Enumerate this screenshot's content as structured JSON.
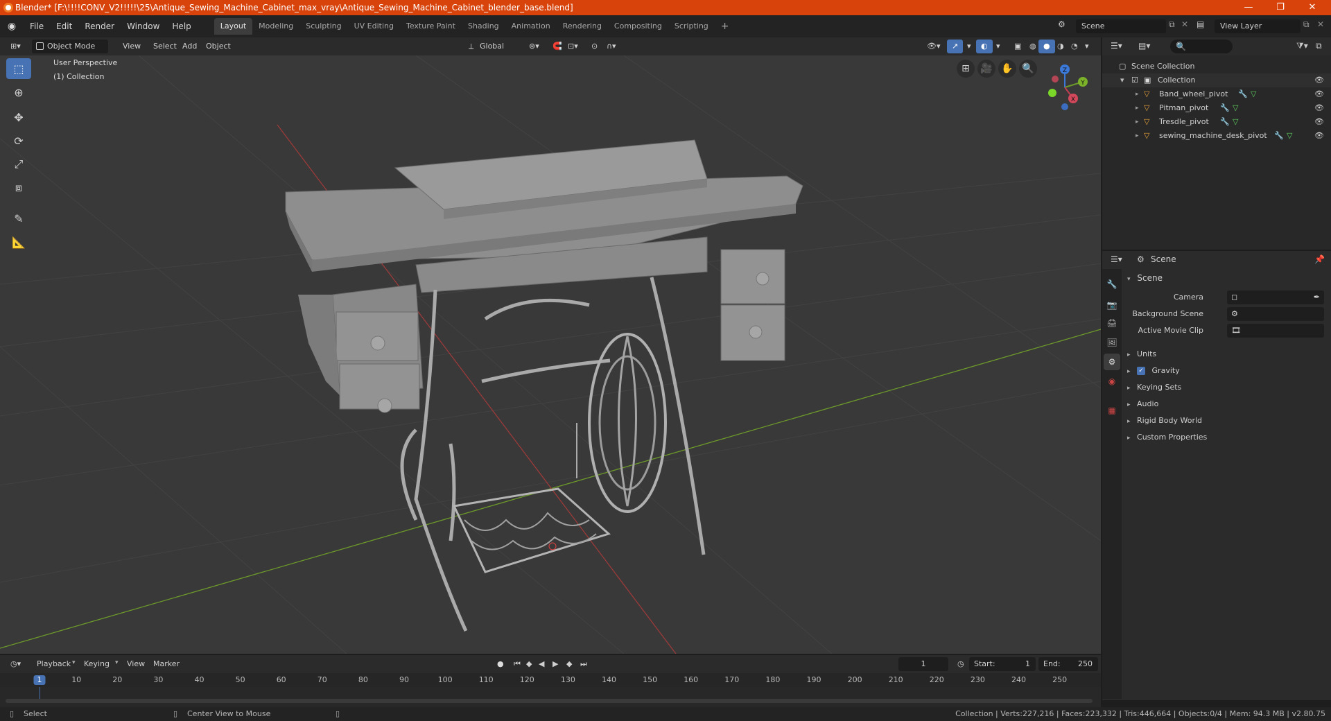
{
  "titlebar": {
    "title": "Blender* [F:\\!!!!CONV_V2!!!!!\\25\\Antique_Sewing_Machine_Cabinet_max_vray\\Antique_Sewing_Machine_Cabinet_blender_base.blend]",
    "minimize": "—",
    "restore": "❐",
    "close": "✕"
  },
  "menu": {
    "items": [
      "File",
      "Edit",
      "Render",
      "Window",
      "Help"
    ],
    "workspaces": [
      "Layout",
      "Modeling",
      "Sculpting",
      "UV Editing",
      "Texture Paint",
      "Shading",
      "Animation",
      "Rendering",
      "Compositing",
      "Scripting"
    ],
    "add_workspace": "+",
    "scene_label": "Scene",
    "view_layer_label": "View Layer"
  },
  "viewport_header": {
    "mode": "Object Mode",
    "menus": [
      "View",
      "Select",
      "Add",
      "Object"
    ],
    "orientation": "Global"
  },
  "viewport": {
    "perspective": "User Perspective",
    "collection": "(1) Collection",
    "axis_x": "X",
    "axis_y": "Y",
    "axis_z": "Z"
  },
  "outliner": {
    "root": "Scene Collection",
    "collection": "Collection",
    "objects": [
      "Band_wheel_pivot",
      "Pitman_pivot",
      "Tresdle_pivot",
      "sewing_machine_desk_pivot"
    ]
  },
  "properties": {
    "header": "Scene",
    "panel_title": "Scene",
    "camera_label": "Camera",
    "background_scene_label": "Background Scene",
    "active_movie_clip_label": "Active Movie Clip",
    "sections": [
      "Units",
      "Gravity",
      "Keying Sets",
      "Audio",
      "Rigid Body World",
      "Custom Properties"
    ],
    "gravity_checked": true
  },
  "timeline": {
    "menus": [
      "Playback",
      "Keying",
      "View",
      "Marker"
    ],
    "current_frame": "1",
    "start_label": "Start:",
    "start_value": "1",
    "end_label": "End:",
    "end_value": "250",
    "ruler": [
      "1",
      "10",
      "20",
      "30",
      "40",
      "50",
      "60",
      "70",
      "80",
      "90",
      "100",
      "110",
      "120",
      "130",
      "140",
      "150",
      "160",
      "170",
      "180",
      "190",
      "200",
      "210",
      "220",
      "230",
      "240",
      "250"
    ]
  },
  "statusbar": {
    "select": "Select",
    "center_view": "Center View to Mouse",
    "stats": "Collection | Verts:227,216 | Faces:223,332 | Tris:446,664 | Objects:0/4 | Mem: 94.3 MB | v2.80.75"
  },
  "colors": {
    "titlebar": "#d8430b",
    "accent": "#4772b3",
    "viewport_bg": "#393939",
    "x_axis": "#9b3a3a",
    "y_axis": "#6d9a2a",
    "object_orange": "#e8a13c",
    "modifier_blue": "#6fa0e6",
    "mesh_green": "#5fd15f"
  }
}
